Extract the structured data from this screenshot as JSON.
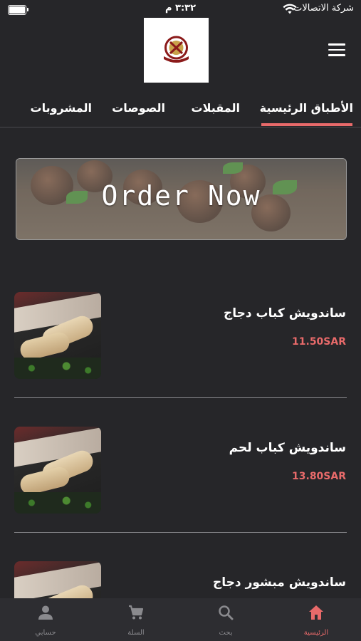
{
  "status_bar": {
    "carrier": "شركة الاتصالات",
    "time": "٣:٣٢ م"
  },
  "header": {
    "logo_icon": "restaurant-logo",
    "menu_icon": "hamburger-menu-icon"
  },
  "tabs": [
    {
      "label": "الأطباق الرئيسية",
      "active": true
    },
    {
      "label": "المقبلات",
      "active": false
    },
    {
      "label": "الصوصات",
      "active": false
    },
    {
      "label": "المشروبات",
      "active": false
    }
  ],
  "banner": {
    "text": "Order Now"
  },
  "products": [
    {
      "name": "ساندويش كباب دجاج",
      "price": "11.50SAR"
    },
    {
      "name": "ساندويش كباب لحم",
      "price": "13.80SAR"
    },
    {
      "name": "ساندويش مبشور دجاج",
      "price": ""
    }
  ],
  "bottom_nav": [
    {
      "label": "الرئيسية",
      "icon": "home-icon",
      "active": true
    },
    {
      "label": "بحث",
      "icon": "search-icon",
      "active": false
    },
    {
      "label": "السلة",
      "icon": "cart-icon",
      "active": false
    },
    {
      "label": "حسابي",
      "icon": "person-icon",
      "active": false
    }
  ],
  "colors": {
    "background": "#262629",
    "accent": "#e86a6a",
    "nav_background": "#2d2d31"
  }
}
